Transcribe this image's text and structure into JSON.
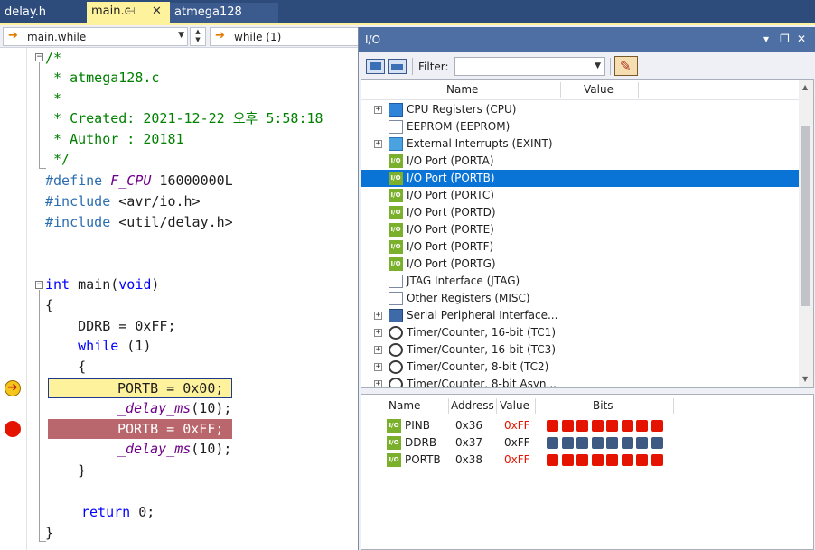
{
  "colors": {
    "tab_strip": "#2d4c7b",
    "active_tab": "#fff29d",
    "current_line_highlight": "#fff29d",
    "breakpoint_line_highlight": "#b9676c",
    "breakpoint_dot": "#e51400",
    "selection": "#0a74d6",
    "bit_set": "#e51400",
    "bit_set_ddrb": "#3f5a82",
    "changed_value": "#e51400",
    "io_title_bar": "#4d6fa3"
  },
  "tabs": [
    {
      "label": "delay.h",
      "active": false
    },
    {
      "label": "main.c",
      "active": true,
      "pin_icon": "pin-icon",
      "close_icon": "close-icon"
    },
    {
      "label": "atmega128",
      "active": false
    }
  ],
  "navbar": {
    "scope_label": "main.while",
    "member_label": "while (1)"
  },
  "code": {
    "line1": "/*",
    "line2": " * atmega128.c",
    "line3": " *",
    "line4": " * Created: 2021-12-22 오후 5:58:18",
    "line5": " * Author : 20181",
    "line6": " */",
    "define_kw": "#define",
    "define_name": "F_CPU",
    "define_val": " 16000000L",
    "include1_kw": "#include",
    "include1_file": " <avr/io.h>",
    "include2_kw": "#include",
    "include2_file": " <util/delay.h>",
    "main_kw": "int",
    "main_rest": " main(",
    "main_void": "void",
    "main_close": ")",
    "brace_open": "{",
    "ddrb": "    DDRB = 0xFF;",
    "while_kw": "while",
    "while_rest": " (1)",
    "inner_open": "    {",
    "portb0": "PORTB = 0x00;",
    "delay1_fn": "_delay_ms",
    "delay1_rest": "(10);",
    "portb1": "PORTB = 0xFF;",
    "delay2_fn": "_delay_ms",
    "delay2_rest": "(10);",
    "inner_close": "    }",
    "return_kw": "return",
    "return_rest": " 0;",
    "brace_close": "}"
  },
  "io_window": {
    "title": "I/O",
    "window_buttons": [
      "▾",
      "❐",
      "✕"
    ],
    "filter_label": "Filter:",
    "filter_value": "",
    "tree_headers": {
      "name": "Name",
      "value": "Value"
    },
    "tree_items": [
      {
        "label": "CPU Registers (CPU)",
        "icon": "chip-icon",
        "expandable": true
      },
      {
        "label": "EEPROM (EEPROM)",
        "icon": "document-icon",
        "expandable": false
      },
      {
        "label": "External Interrupts (EXINT)",
        "icon": "interrupt-icon",
        "expandable": true
      },
      {
        "label": "I/O Port (PORTA)",
        "icon": "io-port-icon",
        "expandable": false
      },
      {
        "label": "I/O Port (PORTB)",
        "icon": "io-port-icon",
        "expandable": false,
        "selected": true
      },
      {
        "label": "I/O Port (PORTC)",
        "icon": "io-port-icon",
        "expandable": false
      },
      {
        "label": "I/O Port (PORTD)",
        "icon": "io-port-icon",
        "expandable": false
      },
      {
        "label": "I/O Port (PORTE)",
        "icon": "io-port-icon",
        "expandable": false
      },
      {
        "label": "I/O Port (PORTF)",
        "icon": "io-port-icon",
        "expandable": false
      },
      {
        "label": "I/O Port (PORTG)",
        "icon": "io-port-icon",
        "expandable": false
      },
      {
        "label": "JTAG Interface (JTAG)",
        "icon": "document-icon",
        "expandable": false
      },
      {
        "label": "Other Registers (MISC)",
        "icon": "document-icon",
        "expandable": false
      },
      {
        "label": "Serial Peripheral Interface...",
        "icon": "spi-icon",
        "expandable": true
      },
      {
        "label": "Timer/Counter, 16-bit (TC1)",
        "icon": "clock-icon",
        "expandable": true
      },
      {
        "label": "Timer/Counter, 16-bit (TC3)",
        "icon": "clock-icon",
        "expandable": true
      },
      {
        "label": "Timer/Counter, 8-bit (TC2)",
        "icon": "clock-icon",
        "expandable": true
      },
      {
        "label": "Timer/Counter, 8-bit Asyn...",
        "icon": "clock-icon",
        "expandable": true
      }
    ],
    "register_headers": {
      "name": "Name",
      "address": "Address",
      "value": "Value",
      "bits": "Bits"
    },
    "registers": [
      {
        "name": "PINB",
        "address": "0x36",
        "value": "0xFF",
        "bits": [
          1,
          1,
          1,
          1,
          1,
          1,
          1,
          1
        ],
        "bit_color": "#e51400",
        "value_color": "#e51400"
      },
      {
        "name": "DDRB",
        "address": "0x37",
        "value": "0xFF",
        "bits": [
          1,
          1,
          1,
          1,
          1,
          1,
          1,
          1
        ],
        "bit_color": "#3f5a82",
        "value_color": "#1e1e1e"
      },
      {
        "name": "PORTB",
        "address": "0x38",
        "value": "0xFF",
        "bits": [
          1,
          1,
          1,
          1,
          1,
          1,
          1,
          1
        ],
        "bit_color": "#e51400",
        "value_color": "#e51400"
      }
    ]
  }
}
